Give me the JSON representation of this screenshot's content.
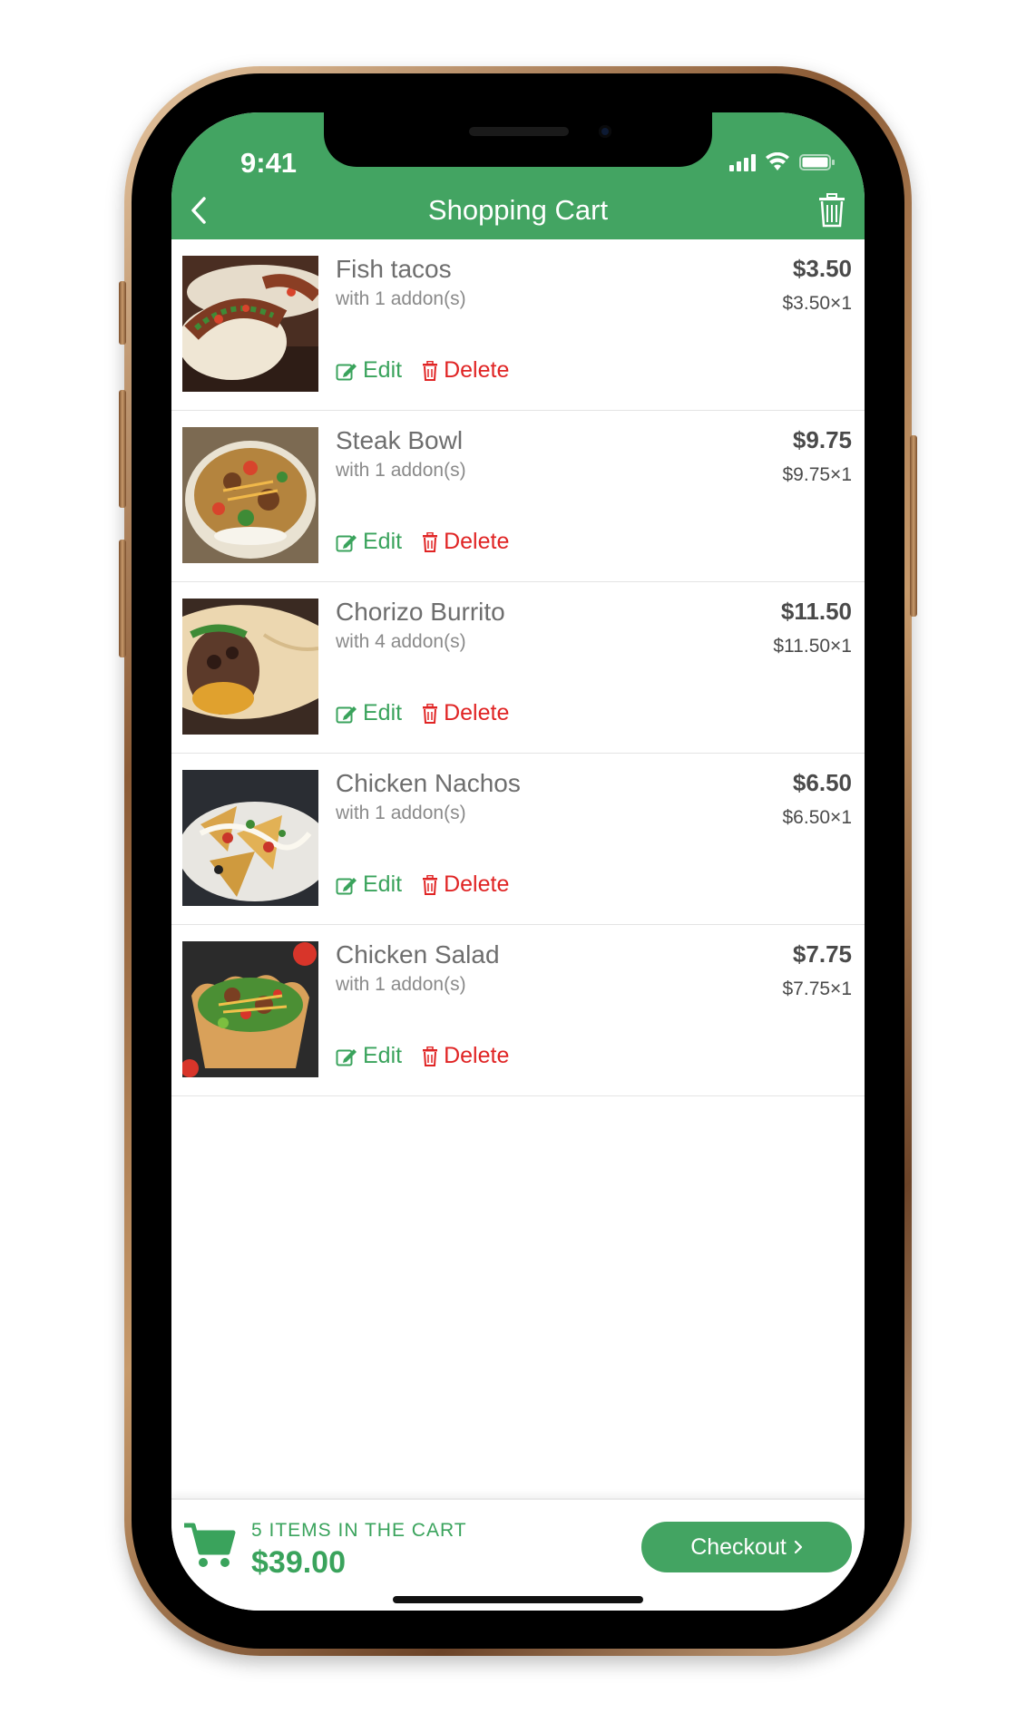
{
  "status_bar": {
    "time": "9:41"
  },
  "header": {
    "title": "Shopping Cart",
    "back_icon": "chevron-left-icon",
    "trash_icon": "trash-icon",
    "color": "#43a462"
  },
  "items": [
    {
      "name": "Fish tacos",
      "addons": "with 1 addon(s)",
      "price": "$3.50",
      "unit": "$3.50×1",
      "edit_label": "Edit",
      "delete_label": "Delete",
      "image": "fish-tacos-photo"
    },
    {
      "name": "Steak Bowl",
      "addons": "with 1 addon(s)",
      "price": "$9.75",
      "unit": "$9.75×1",
      "edit_label": "Edit",
      "delete_label": "Delete",
      "image": "steak-bowl-photo"
    },
    {
      "name": "Chorizo Burrito",
      "addons": "with 4 addon(s)",
      "price": "$11.50",
      "unit": "$11.50×1",
      "edit_label": "Edit",
      "delete_label": "Delete",
      "image": "chorizo-burrito-photo"
    },
    {
      "name": "Chicken Nachos",
      "addons": "with 1 addon(s)",
      "price": "$6.50",
      "unit": "$6.50×1",
      "edit_label": "Edit",
      "delete_label": "Delete",
      "image": "chicken-nachos-photo"
    },
    {
      "name": "Chicken Salad",
      "addons": "with 1 addon(s)",
      "price": "$7.75",
      "unit": "$7.75×1",
      "edit_label": "Edit",
      "delete_label": "Delete",
      "image": "chicken-salad-photo"
    }
  ],
  "footer": {
    "count_label": "5 ITEMS IN THE CART",
    "total": "$39.00",
    "checkout_label": "Checkout",
    "cart_icon": "shopping-cart-icon"
  },
  "colors": {
    "accent": "#43a462",
    "delete": "#e02424"
  }
}
